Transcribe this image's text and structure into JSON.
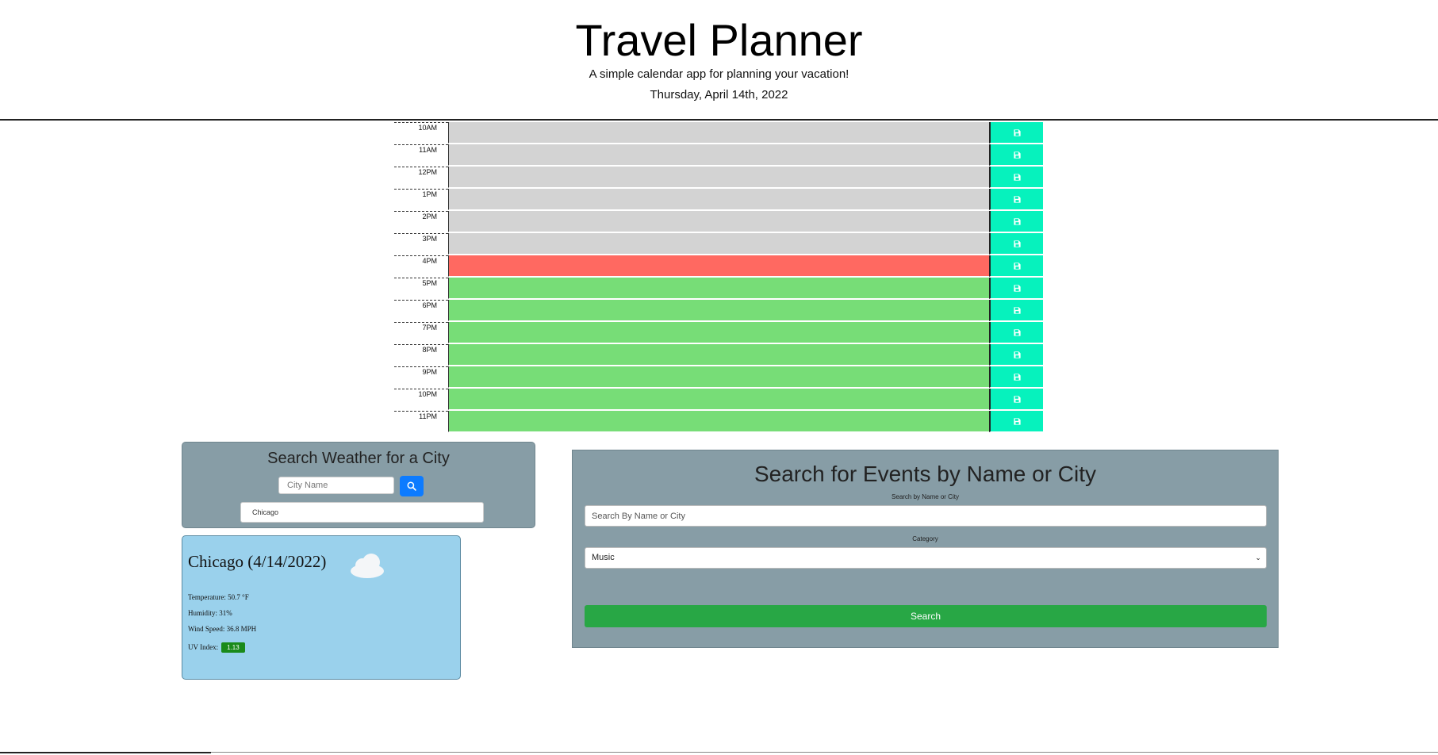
{
  "header": {
    "title": "Travel Planner",
    "subtitle": "A simple calendar app for planning your vacation!",
    "date": "Thursday, April 14th, 2022"
  },
  "planner": {
    "rows": [
      {
        "hour": "10AM",
        "state": "past"
      },
      {
        "hour": "11AM",
        "state": "past"
      },
      {
        "hour": "12PM",
        "state": "past"
      },
      {
        "hour": "1PM",
        "state": "past"
      },
      {
        "hour": "2PM",
        "state": "past"
      },
      {
        "hour": "3PM",
        "state": "past"
      },
      {
        "hour": "4PM",
        "state": "present"
      },
      {
        "hour": "5PM",
        "state": "future"
      },
      {
        "hour": "6PM",
        "state": "future"
      },
      {
        "hour": "7PM",
        "state": "future"
      },
      {
        "hour": "8PM",
        "state": "future"
      },
      {
        "hour": "9PM",
        "state": "future"
      },
      {
        "hour": "10PM",
        "state": "future"
      },
      {
        "hour": "11PM",
        "state": "future"
      }
    ],
    "colors": {
      "past": "#d3d3d3",
      "present": "#ff6961",
      "future": "#77dd77",
      "save": "#06f2bd"
    },
    "save_icon": "floppy-disk-icon"
  },
  "weather_search": {
    "title": "Search Weather for a City",
    "city_placeholder": "City Name",
    "search_icon": "search-icon",
    "history": [
      "Chicago"
    ]
  },
  "weather_card": {
    "city_date": "Chicago (4/14/2022)",
    "icon": "cloud-icon",
    "temperature": "Temperature: 50.7 °F",
    "humidity": "Humidity: 31%",
    "wind": "Wind Speed: 36.8 MPH",
    "uv_label": "UV Index:",
    "uv_value": "1.13",
    "uv_color": "#1a8a1a"
  },
  "events": {
    "title": "Search for Events by Name or City",
    "search_label": "Search by Name or City",
    "search_placeholder": "Search By Name or City",
    "category_label": "Category",
    "category_value": "Music",
    "search_button": "Search",
    "button_color": "#28a745"
  }
}
